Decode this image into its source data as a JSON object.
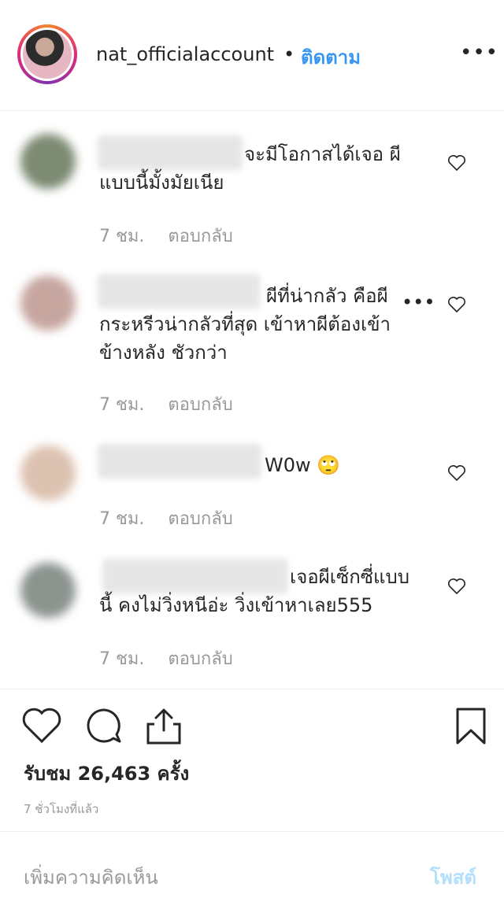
{
  "header": {
    "username": "nat_officialaccount",
    "separator": "•",
    "follow_label": "ติดตาม",
    "more_label": "•••"
  },
  "comments": [
    {
      "text_lines": [
        "จะมีโอกาสได้เจอ ผี",
        "แบบนี้มั้งมัยเนีย"
      ],
      "time": "7 ชม.",
      "reply_label": "ตอบกลับ",
      "avatar_color": "#7d8b73"
    },
    {
      "text_lines": [
        "ผีที่น่ากลัว คือผี",
        "กระหรีวน่ากลัวที่สุด เข้าหาผีต้องเข้า",
        "ข้างหลัง ชัวกว่า"
      ],
      "more_label": "•••",
      "time": "7 ชม.",
      "reply_label": "ตอบกลับ",
      "avatar_color": "#c7a6a0"
    },
    {
      "text_lines": [
        "W0w 🙄"
      ],
      "time": "7 ชม.",
      "reply_label": "ตอบกลับ",
      "avatar_color": "#dcc2b0"
    },
    {
      "text_lines": [
        "เจอผีเซ็กซี่แบบ",
        "นี้ คงไม่วิ่งหนีอ่ะ วิ่งเข้าหาเลย555"
      ],
      "time": "7 ชม.",
      "reply_label": "ตอบกลับ",
      "avatar_color": "#8c948f"
    }
  ],
  "stats": {
    "views": "รับชม 26,463 ครั้ง",
    "time_ago": "7 ชั่วโมงที่แล้ว"
  },
  "composer": {
    "placeholder": "เพิ่มความคิดเห็น",
    "post_label": "โพสต์"
  },
  "colors": {
    "accent": "#3897f0",
    "post_disabled": "#b2dffc",
    "meta_text": "#999999"
  }
}
